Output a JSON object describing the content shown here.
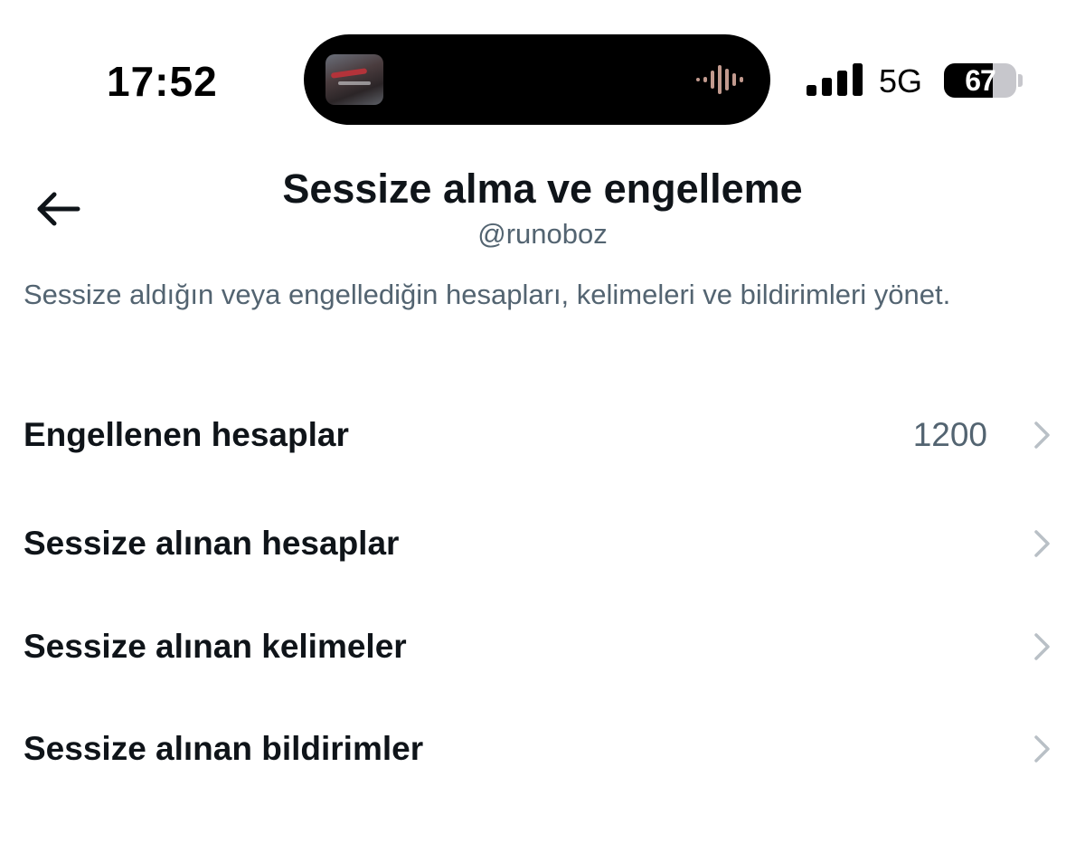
{
  "status_bar": {
    "time": "17:52",
    "network": "5G",
    "battery_level": "67",
    "battery_fraction": 0.67,
    "signal_bars": 4
  },
  "dynamic_island": {
    "activity": "now-playing",
    "icons": [
      "album-artwork",
      "waveform-icon"
    ]
  },
  "header": {
    "back_icon": "arrow-left-icon",
    "title": "Sessize alma ve engelleme",
    "subtitle": "@runoboz"
  },
  "description": "Sessize aldığın veya engellediğin hesapları, kelimeleri ve bildirimleri yönet.",
  "menu": {
    "items": [
      {
        "label": "Engellenen hesaplar",
        "count": "1200"
      },
      {
        "label": "Sessize alınan hesaplar",
        "count": ""
      },
      {
        "label": "Sessize alınan kelimeler",
        "count": ""
      },
      {
        "label": "Sessize alınan bildirimler",
        "count": ""
      }
    ],
    "chevron_icon": "chevron-right-icon"
  },
  "colors": {
    "text_primary": "#0f1419",
    "text_secondary": "#536471",
    "chevron": "#b9c0c6",
    "background": "#ffffff",
    "waveform": "#c29a8e"
  }
}
